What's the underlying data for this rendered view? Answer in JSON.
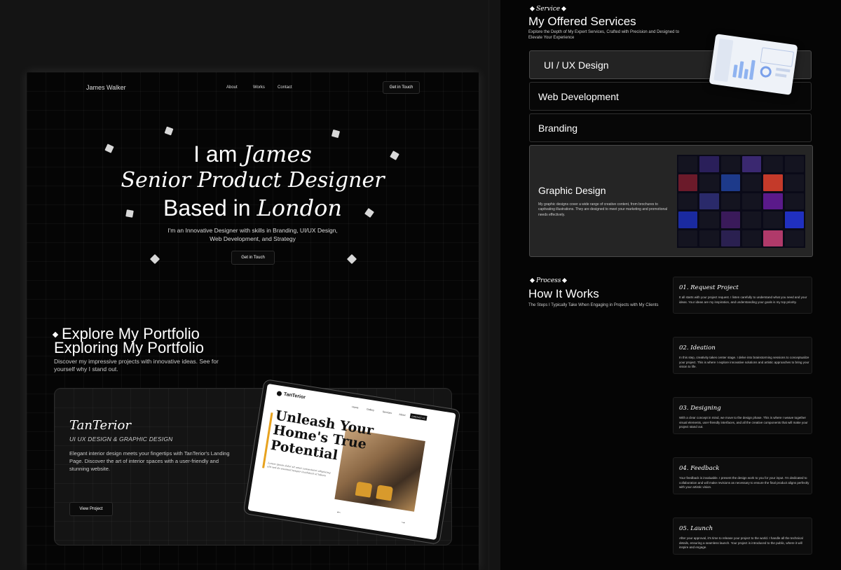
{
  "portfolio_page": {
    "brand": "James Walker",
    "nav": [
      "About",
      "Works",
      "Contact"
    ],
    "get_in_touch": "Get in Touch",
    "hero": {
      "line1_a": "I am ",
      "line1_b": "James",
      "line2": "Senior Product Designer",
      "line3_a": "Based in ",
      "line3_b": "London",
      "description": "I'm an Innovative Designer with skills in Branding, UI/UX Design, Web Development, and Strategy",
      "cta": "Get in Touch"
    },
    "portfolio": {
      "eyebrow": "Explore My Portfolio",
      "title": "Exploring My Portfolio",
      "subtitle": "Discover my impressive projects with innovative ideas. See for yourself why I stand out."
    },
    "project": {
      "name": "TanTerior",
      "category": "UI UX DESIGN & GRAPHIC DESIGN",
      "description": "Elegant interior design meets your fingertips with TanTerior's Landing Page. Discover the art of interior spaces with a user-friendly and stunning website.",
      "button": "View Project",
      "mockup": {
        "logo": "TanTerior",
        "nav": [
          "Home",
          "Gallery",
          "Services",
          "About"
        ],
        "button": "CONTACT US",
        "headline": "Unleash Your Home's True Potential"
      }
    }
  },
  "services_page": {
    "eyebrow": "Service",
    "title": "My Offered Services",
    "subtitle": "Explore the Depth of My Expert Services, Crafted with Precision and Designed to Elevate Your Experience",
    "services": [
      "UI / UX Design",
      "Web Development",
      "Branding"
    ],
    "featured": {
      "title": "Graphic Design",
      "description": "My graphic designs cover a wide range of creative content, from brochures to captivating illustrations. They are designed to meet your marketing and promotional needs effectively."
    },
    "process": {
      "eyebrow": "Process",
      "title": "How It Works",
      "subtitle": "The Steps I Typically Take When Engaging in Projects with My Clients",
      "steps": [
        {
          "title": "01.  Request Project",
          "desc": "It all starts with your project request. I listen carefully to understand what you need and your ideas. Your ideas are my inspiration, and understanding your goals is my top priority."
        },
        {
          "title": "02. Ideation",
          "desc": "In this step, creativity takes center stage. I delve into brainstorming sessions to conceptualize your project. This is where I explore innovative solutions and artistic approaches to bring your vision to life."
        },
        {
          "title": "03. Designing",
          "desc": "With a clear concept in mind, we move to the design phase. This is where I weave together visual elements, user-friendly interfaces, and all the creative components that will make your project stand out."
        },
        {
          "title": "04. Feedback",
          "desc": "Your feedback is invaluable. I present the design work to you for your input. I'm dedicated to collaboration and will make revisions as necessary to ensure the final product aligns perfectly with your artistic vision."
        },
        {
          "title": "05. Launch",
          "desc": "After your approval, it's time to release your project to the world. I handle all the technical details, ensuring a seamless launch. Your project is introduced to the public, where it will inspire and engage."
        }
      ]
    }
  },
  "colors": {
    "background": "#050505",
    "card": "#141414",
    "accent": "#e7a21f"
  }
}
